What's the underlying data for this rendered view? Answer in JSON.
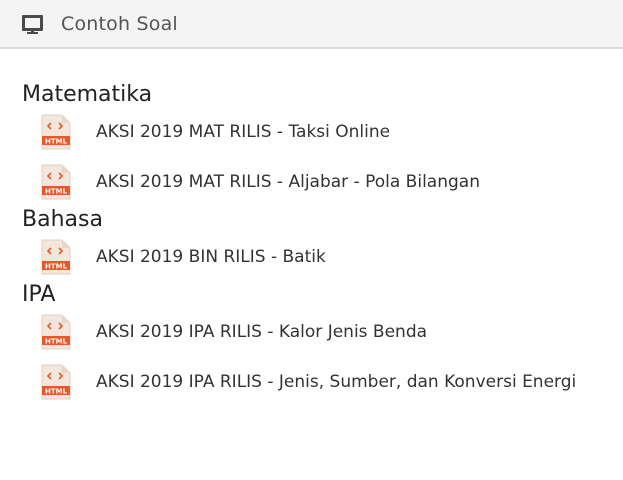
{
  "header": {
    "title": "Contoh Soal",
    "icon": "monitor-icon"
  },
  "colors": {
    "file_icon_orange": "#e8582a",
    "file_icon_light": "#f3e6dc",
    "header_bg": "#f4f4f4"
  },
  "sections": [
    {
      "title": "Matematika",
      "items": [
        {
          "label": "AKSI 2019 MAT RILIS - Taksi Online",
          "badge": "HTML"
        },
        {
          "label": "AKSI 2019 MAT RILIS - Aljabar - Pola Bilangan",
          "badge": "HTML"
        }
      ]
    },
    {
      "title": "Bahasa",
      "items": [
        {
          "label": "AKSI 2019 BIN RILIS - Batik",
          "badge": "HTML"
        }
      ]
    },
    {
      "title": "IPA",
      "items": [
        {
          "label": "AKSI 2019 IPA RILIS - Kalor Jenis Benda",
          "badge": "HTML"
        },
        {
          "label": "AKSI 2019 IPA RILIS - Jenis, Sumber, dan Konversi Energi",
          "badge": "HTML"
        }
      ]
    }
  ]
}
